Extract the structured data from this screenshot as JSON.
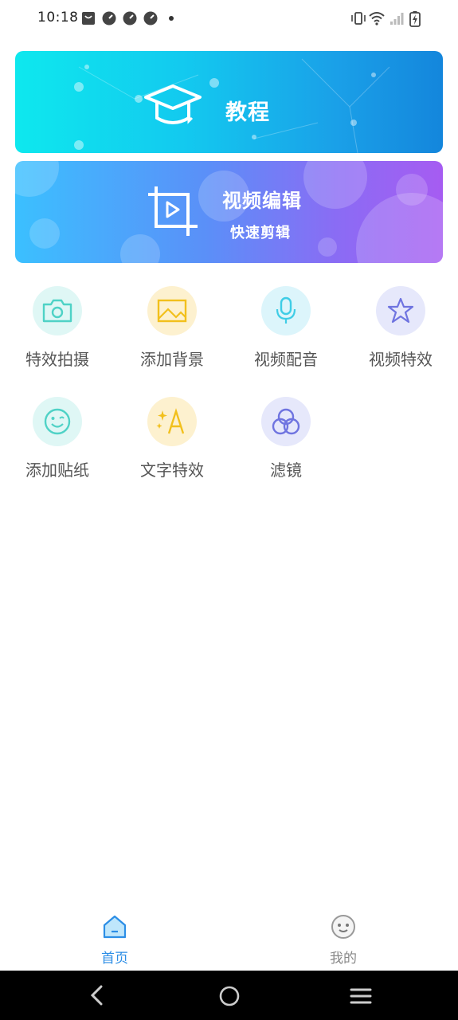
{
  "status_bar": {
    "time": "10:18"
  },
  "banners": {
    "tutorial": {
      "title": "教程"
    },
    "video_edit": {
      "title": "视频编辑",
      "subtitle": "快速剪辑"
    }
  },
  "tools": [
    {
      "label": "特效拍摄",
      "icon": "camera-icon"
    },
    {
      "label": "添加背景",
      "icon": "image-icon"
    },
    {
      "label": "视频配音",
      "icon": "microphone-icon"
    },
    {
      "label": "视频特效",
      "icon": "star-icon"
    },
    {
      "label": "添加贴纸",
      "icon": "smiley-icon"
    },
    {
      "label": "文字特效",
      "icon": "text-sparkle-icon"
    },
    {
      "label": "滤镜",
      "icon": "filter-icon"
    }
  ],
  "bottom_nav": {
    "home": {
      "label": "首页",
      "active": true
    },
    "mine": {
      "label": "我的",
      "active": false
    }
  },
  "colors": {
    "accent": "#2c8ee6",
    "tutorial_banner_start": "#0ee8ee",
    "tutorial_banner_end": "#1486dc",
    "edit_banner_start": "#3bc0ff",
    "edit_banner_end": "#a65cf2"
  }
}
